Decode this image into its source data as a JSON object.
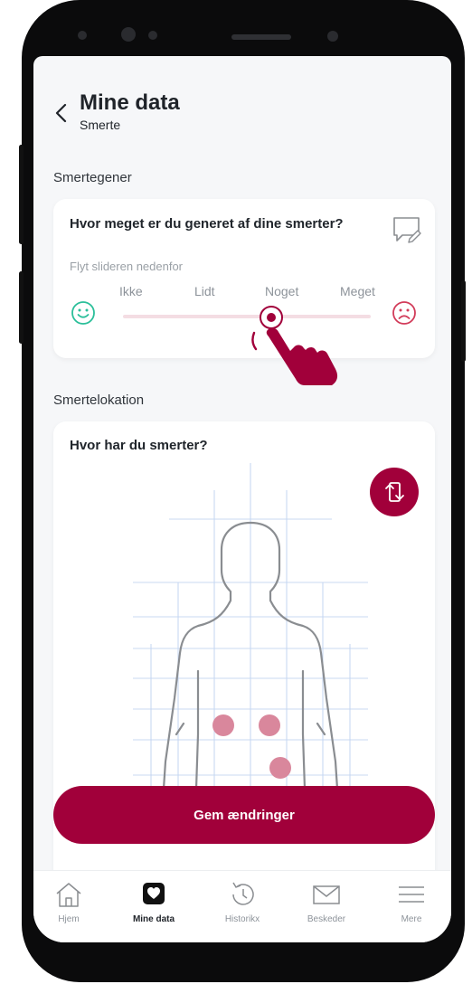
{
  "header": {
    "title": "Mine data",
    "subtitle": "Smerte"
  },
  "sections": {
    "pain_level_label": "Smertegener",
    "pain_location_label": "Smertelokation"
  },
  "pain_card": {
    "question": "Hvor meget er du generet af dine smerter?",
    "hint": "Flyt slideren nedenfor",
    "levels": [
      "Ikke",
      "Lidt",
      "Noget",
      "Meget"
    ],
    "selected_level": "Noget",
    "slider_value_fraction": 0.6
  },
  "location_card": {
    "question": "Hvor har du smerter?",
    "view": "back",
    "marked_areas": [
      "lower-back-left",
      "lower-back-right",
      "right-buttock"
    ]
  },
  "actions": {
    "save_label": "Gem ændringer"
  },
  "nav": {
    "items": [
      {
        "label": "Hjem",
        "icon": "home-icon"
      },
      {
        "label": "Mine data",
        "icon": "heart-icon"
      },
      {
        "label": "Historikx",
        "icon": "history-icon"
      },
      {
        "label": "Beskeder",
        "icon": "mail-icon"
      },
      {
        "label": "Mere",
        "icon": "menu-icon"
      }
    ],
    "active": "Mine data"
  },
  "colors": {
    "accent": "#a1003a",
    "happy": "#2bbf9a",
    "sad": "#d23c5a",
    "body_outline": "#8a8d91",
    "marker": "#d9879c"
  }
}
